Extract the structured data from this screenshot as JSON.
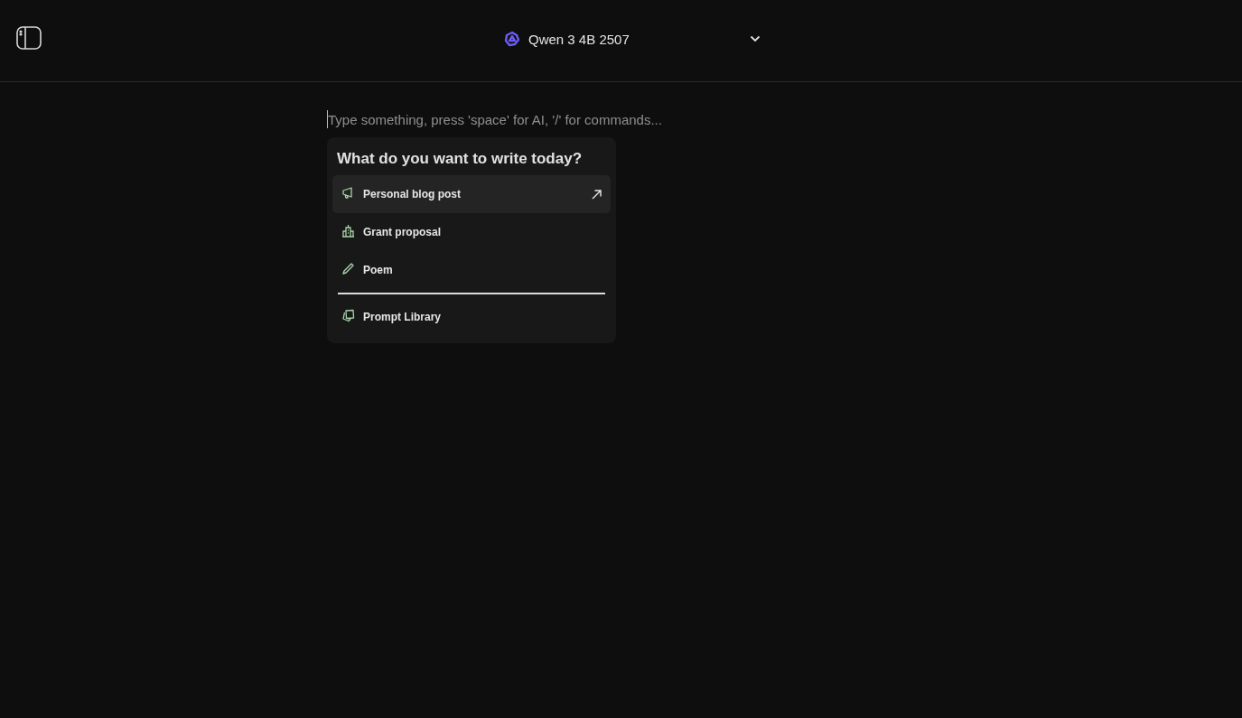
{
  "header": {
    "model": "Qwen 3 4B 2507"
  },
  "editor": {
    "placeholder": "Type something, press 'space' for AI, '/' for commands..."
  },
  "menu": {
    "title": "What do you want to write today?",
    "items": [
      {
        "label": "Personal blog post",
        "kind": "megaphone",
        "selected": true
      },
      {
        "label": "Grant proposal",
        "kind": "building",
        "selected": false
      },
      {
        "label": "Poem",
        "kind": "pencil",
        "selected": false
      }
    ],
    "footer_items": [
      {
        "label": "Prompt Library",
        "kind": "cards",
        "selected": false
      }
    ]
  }
}
